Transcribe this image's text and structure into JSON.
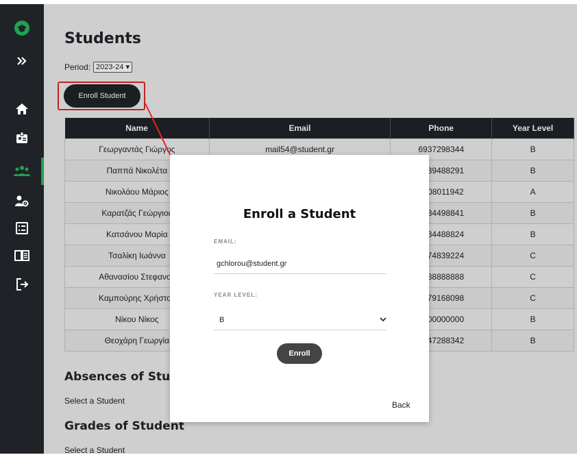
{
  "header": {
    "title": "Students",
    "period_label": "Period:",
    "period_value": "2023-24"
  },
  "enroll_button": "Enroll Student",
  "table": {
    "columns": [
      "Name",
      "Email",
      "Phone",
      "Year Level"
    ],
    "rows": [
      [
        "Γεωργαντάς Γιώργος",
        "mail54@student.gr",
        "6937298344",
        "B"
      ],
      [
        "Παππά Νικολέτα",
        "",
        "6939488291",
        "B"
      ],
      [
        "Νικολάου Μάριος",
        "",
        "6908011942",
        "A"
      ],
      [
        "Καρατζάς Γεώργιος",
        "",
        "6934498841",
        "B"
      ],
      [
        "Κατσάνου Μαρία",
        "",
        "6934488824",
        "B"
      ],
      [
        "Τσαλίκη Ιωάννα",
        "",
        "6974839224",
        "C"
      ],
      [
        "Αθανασίου Στεφανος",
        "",
        "6988888888",
        "C"
      ],
      [
        "Καμπούρης Χρήστος",
        "",
        "6979168098",
        "C"
      ],
      [
        "Νίκου Νίκος",
        "",
        "6900000000",
        "B"
      ],
      [
        "Θεοχάρη Γεωργία",
        "",
        "6947288342",
        "B"
      ]
    ]
  },
  "sections": {
    "absences_title": "Absences of Student",
    "absences_text": "Select a Student",
    "grades_title": "Grades of Student",
    "grades_text": "Select a Student"
  },
  "modal": {
    "title": "Enroll a Student",
    "email_label": "EMAIL:",
    "email_value": "gchlorou@student.gr",
    "year_label": "YEAR LEVEL:",
    "year_value": "B",
    "enroll_button": "Enroll",
    "back_link": "Back"
  },
  "sidebar": {
    "icons": [
      "logo-icon",
      "expand-icon",
      "home-icon",
      "badge-icon",
      "students-icon",
      "teachers-settings-icon",
      "list-icon",
      "book-icon",
      "logout-icon"
    ]
  },
  "colors": {
    "dark": "#1f2328",
    "accent_green": "#22a052",
    "highlight_red": "#e02626"
  }
}
